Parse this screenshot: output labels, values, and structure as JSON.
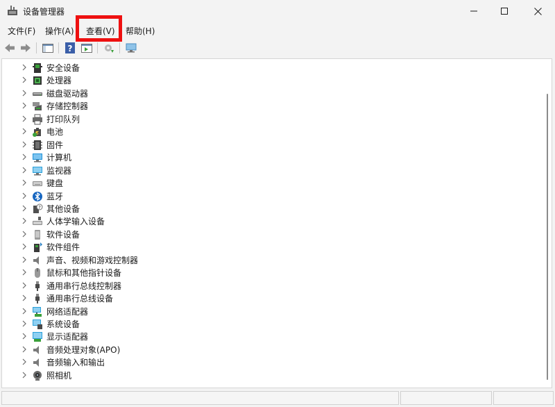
{
  "window": {
    "title": "设备管理器"
  },
  "menu": {
    "file": "文件(F)",
    "action": "操作(A)",
    "view": "查看(V)",
    "help": "帮助(H)"
  },
  "toolbar": {
    "icons": [
      "back-arrow-icon",
      "forward-arrow-icon",
      "console-tree-icon",
      "help-icon",
      "properties-icon",
      "update-driver-icon",
      "scan-hardware-icon"
    ]
  },
  "tree": {
    "items": [
      {
        "label": "安全设备",
        "icon": "security-device-icon"
      },
      {
        "label": "处理器",
        "icon": "processor-icon"
      },
      {
        "label": "磁盘驱动器",
        "icon": "disk-drive-icon"
      },
      {
        "label": "存储控制器",
        "icon": "storage-controller-icon"
      },
      {
        "label": "打印队列",
        "icon": "printer-icon"
      },
      {
        "label": "电池",
        "icon": "battery-icon"
      },
      {
        "label": "固件",
        "icon": "firmware-icon"
      },
      {
        "label": "计算机",
        "icon": "computer-icon"
      },
      {
        "label": "监视器",
        "icon": "monitor-icon"
      },
      {
        "label": "键盘",
        "icon": "keyboard-icon"
      },
      {
        "label": "蓝牙",
        "icon": "bluetooth-icon"
      },
      {
        "label": "其他设备",
        "icon": "other-device-icon"
      },
      {
        "label": "人体学输入设备",
        "icon": "hid-icon"
      },
      {
        "label": "软件设备",
        "icon": "software-device-icon"
      },
      {
        "label": "软件组件",
        "icon": "software-component-icon"
      },
      {
        "label": "声音、视频和游戏控制器",
        "icon": "speaker-icon"
      },
      {
        "label": "鼠标和其他指针设备",
        "icon": "mouse-icon"
      },
      {
        "label": "通用串行总线控制器",
        "icon": "usb-icon"
      },
      {
        "label": "通用串行总线设备",
        "icon": "usb-device-icon"
      },
      {
        "label": "网络适配器",
        "icon": "network-adapter-icon"
      },
      {
        "label": "系统设备",
        "icon": "system-device-icon"
      },
      {
        "label": "显示适配器",
        "icon": "display-adapter-icon"
      },
      {
        "label": "音频处理对象(APO)",
        "icon": "audio-processing-icon"
      },
      {
        "label": "音频输入和输出",
        "icon": "audio-io-icon"
      },
      {
        "label": "照相机",
        "icon": "camera-icon"
      }
    ]
  },
  "colors": {
    "highlight": "#ee1010",
    "background": "#f3f3f3",
    "tree_background": "#ffffff"
  }
}
